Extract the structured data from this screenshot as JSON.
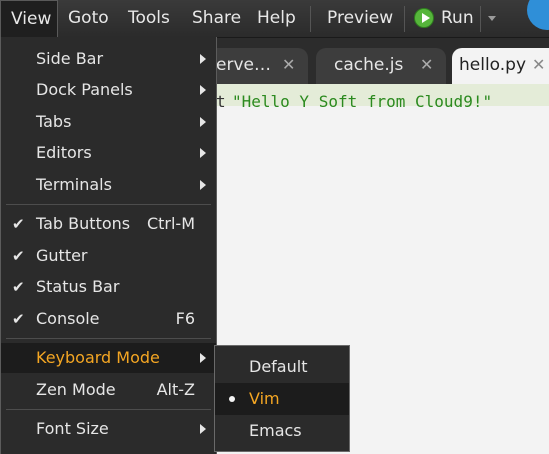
{
  "menubar": {
    "items": [
      "View",
      "Goto",
      "Tools",
      "Share",
      "Help"
    ],
    "preview_label": "Preview",
    "run_label": "Run"
  },
  "tabs": [
    {
      "label": "erve…",
      "active": false
    },
    {
      "label": "cache.js",
      "active": false
    },
    {
      "label": "hello.py",
      "active": true
    }
  ],
  "tab_close_glyph": "✕",
  "editor": {
    "code_prefix": "t",
    "code_string": "\"Hello Y Soft from Cloud9!\""
  },
  "view_menu": {
    "items": [
      {
        "label": "Side Bar",
        "submenu": true
      },
      {
        "label": "Dock Panels",
        "submenu": true
      },
      {
        "label": "Tabs",
        "submenu": true
      },
      {
        "label": "Editors",
        "submenu": true
      },
      {
        "label": "Terminals",
        "submenu": true
      },
      {
        "label": "Tab Buttons",
        "checked": true,
        "shortcut": "Ctrl-M"
      },
      {
        "label": "Gutter",
        "checked": true
      },
      {
        "label": "Status Bar",
        "checked": true
      },
      {
        "label": "Console",
        "checked": true,
        "shortcut": "F6"
      },
      {
        "label": "Keyboard Mode",
        "submenu": true,
        "highlighted": true
      },
      {
        "label": "Zen Mode",
        "shortcut": "Alt-Z"
      },
      {
        "label": "Font Size",
        "submenu": true
      }
    ]
  },
  "keyboard_mode_menu": {
    "items": [
      {
        "label": "Default",
        "selected": false
      },
      {
        "label": "Vim",
        "selected": true
      },
      {
        "label": "Emacs",
        "selected": false
      }
    ]
  },
  "colors": {
    "accent": "#f4a623",
    "run_green": "#56b53b",
    "code_string": "#2b8a1f"
  },
  "icons": {
    "check": "✔",
    "run": "play-circle-icon",
    "submenu_arrow": "chevron-right-icon"
  }
}
